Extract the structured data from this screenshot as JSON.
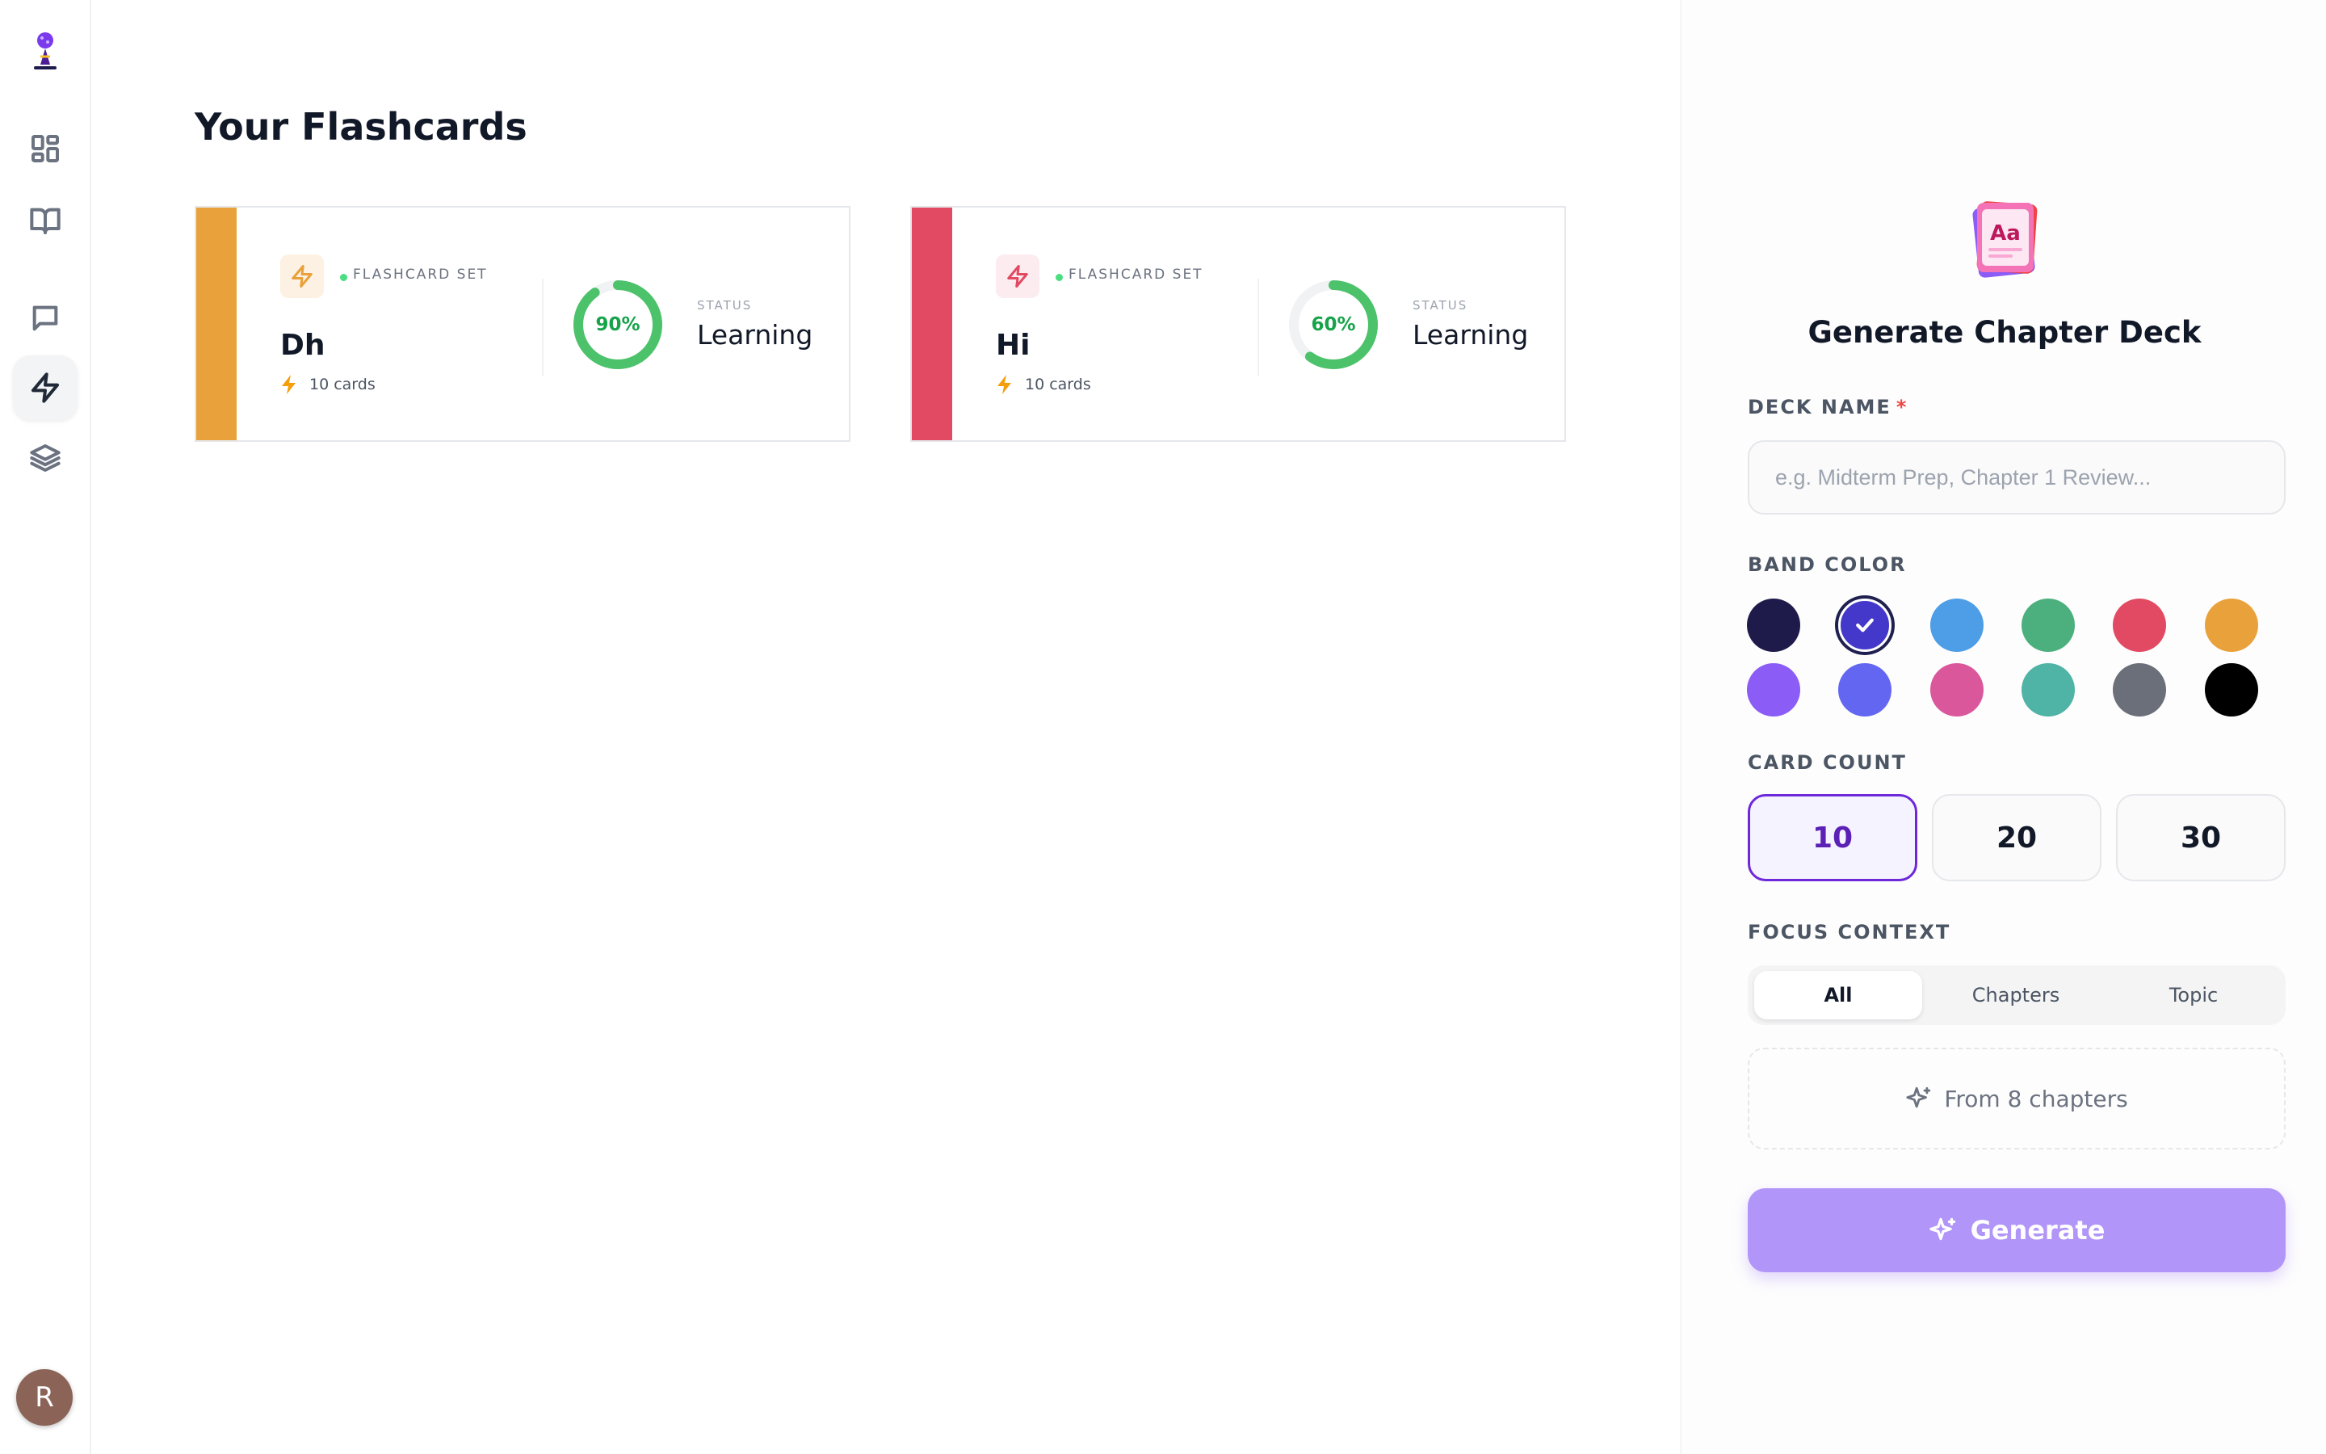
{
  "page": {
    "title": "Your Flashcards"
  },
  "rail": {
    "logo_icon": "rocket-brain-logo",
    "items": [
      {
        "icon": "dashboard-icon"
      },
      {
        "icon": "book-icon"
      },
      {
        "icon": "chat-icon"
      },
      {
        "icon": "lightning-icon",
        "active": true
      },
      {
        "icon": "layers-icon"
      }
    ],
    "avatar_initial": "R"
  },
  "cards": [
    {
      "band_color": "#e9a23b",
      "icon_bg": "#fdf1e3",
      "icon_color": "#e9a23b",
      "kind": "FLASHCARD SET",
      "name": "Dh",
      "count": "10 cards",
      "progress": 0.9,
      "progress_label": "90%",
      "status_label": "STATUS",
      "status": "Learning"
    },
    {
      "band_color": "#e14a62",
      "icon_bg": "#fdecef",
      "icon_color": "#e14a62",
      "kind": "FLASHCARD SET",
      "name": "Hi",
      "count": "10 cards",
      "progress": 0.6,
      "progress_label": "60%",
      "status_label": "STATUS",
      "status": "Learning"
    }
  ],
  "panel": {
    "title": "Generate Chapter Deck",
    "deck_name_label": "DECK NAME",
    "deck_name_required": "*",
    "deck_name_value": "",
    "deck_name_placeholder": "e.g. Midterm Prep, Chapter 1 Review...",
    "band_color_label": "BAND COLOR",
    "band_colors": [
      {
        "color": "#1e1b4b",
        "selected": false
      },
      {
        "color": "#4338ca",
        "selected": true
      },
      {
        "color": "#4d9ee6",
        "selected": false
      },
      {
        "color": "#4bb07d",
        "selected": false
      },
      {
        "color": "#e14a62",
        "selected": false
      },
      {
        "color": "#e9a23b",
        "selected": false
      },
      {
        "color": "#8b5cf6",
        "selected": false
      },
      {
        "color": "#6366f1",
        "selected": false
      },
      {
        "color": "#db579c",
        "selected": false
      },
      {
        "color": "#4fb3a5",
        "selected": false
      },
      {
        "color": "#6b6f7a",
        "selected": false
      },
      {
        "color": "#000000",
        "selected": false
      }
    ],
    "card_count_label": "CARD COUNT",
    "card_counts": [
      "10",
      "20",
      "30"
    ],
    "card_count_selected": "10",
    "focus_label": "FOCUS CONTEXT",
    "focus_options": [
      "All",
      "Chapters",
      "Topic"
    ],
    "focus_selected": "All",
    "from_text": "From 8 chapters",
    "generate_label": "Generate"
  }
}
